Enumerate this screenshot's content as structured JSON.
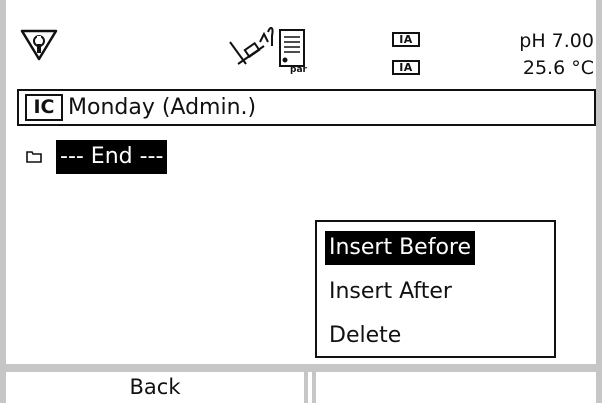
{
  "status": {
    "ia_badge_1": "IA",
    "ia_badge_2": "IA",
    "ph_value": "pH 7.00",
    "temperature": "25.6 °C",
    "sensor_icon_label": "par"
  },
  "title_bar": {
    "badge": "IC",
    "title": "Monday (Admin.)"
  },
  "list": {
    "items": [
      {
        "label": "--- End ---",
        "selected": true
      }
    ]
  },
  "popup_menu": {
    "items": [
      {
        "label": "Insert Before",
        "selected": true
      },
      {
        "label": "Insert After",
        "selected": false
      },
      {
        "label": "Delete",
        "selected": false
      }
    ]
  },
  "softkeys": {
    "left": "Back",
    "right": ""
  }
}
